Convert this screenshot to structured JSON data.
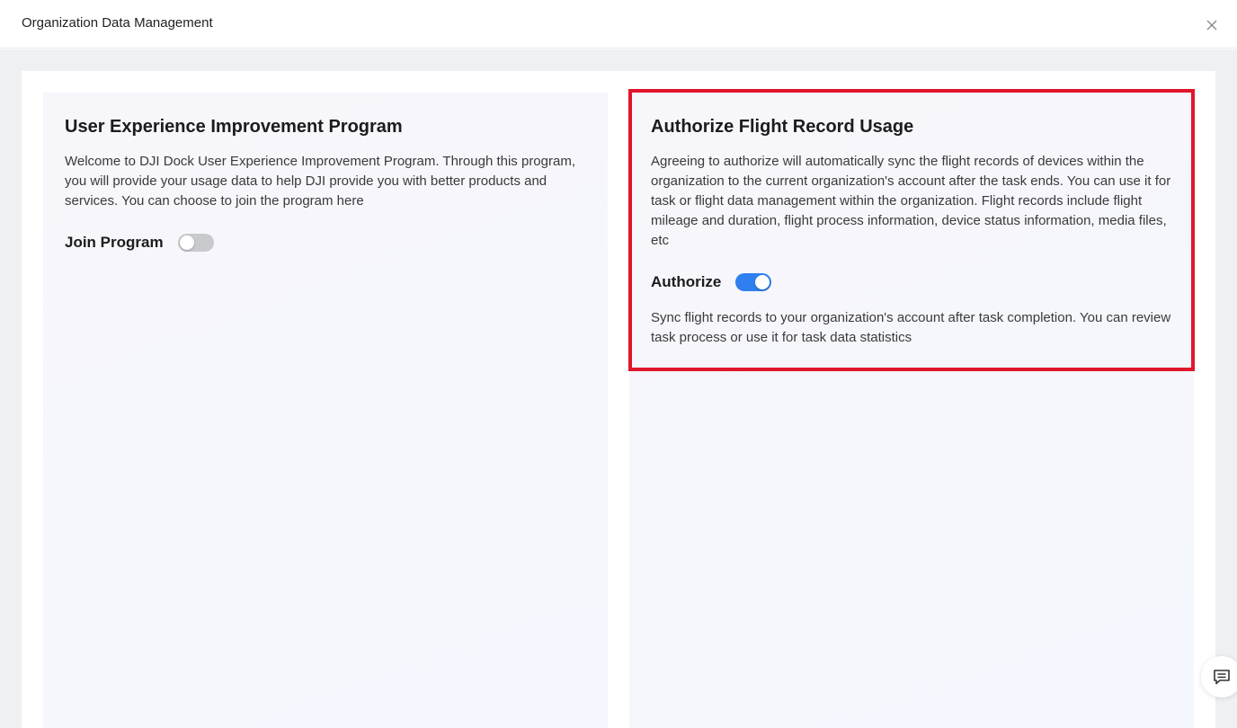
{
  "dialog": {
    "title": "Organization Data Management",
    "close_icon": "close-icon"
  },
  "ux_program": {
    "title": "User Experience Improvement Program",
    "description": "Welcome to DJI Dock User Experience Improvement Program. Through this program, you will provide your usage data to help DJI provide you with better products and services. You can choose to join the program here",
    "toggle_label": "Join Program",
    "toggle_on": false
  },
  "flight_record": {
    "title": "Authorize Flight Record Usage",
    "description": "Agreeing to authorize will automatically sync the flight records of devices within the organization to the current organization's account after the task ends. You can use it for task or flight data management within the organization. Flight records include flight mileage and duration, flight process information, device status information, media files, etc",
    "toggle_label": "Authorize",
    "toggle_on": true,
    "note": "Sync flight records to your organization's account after task completion. You can review task process or use it for task data statistics"
  },
  "colors": {
    "accent": "#2f7ff0",
    "highlight": "#e0162b",
    "toggle_off": "#c9cacd"
  },
  "feedback": {
    "icon": "chat-feedback-icon"
  }
}
